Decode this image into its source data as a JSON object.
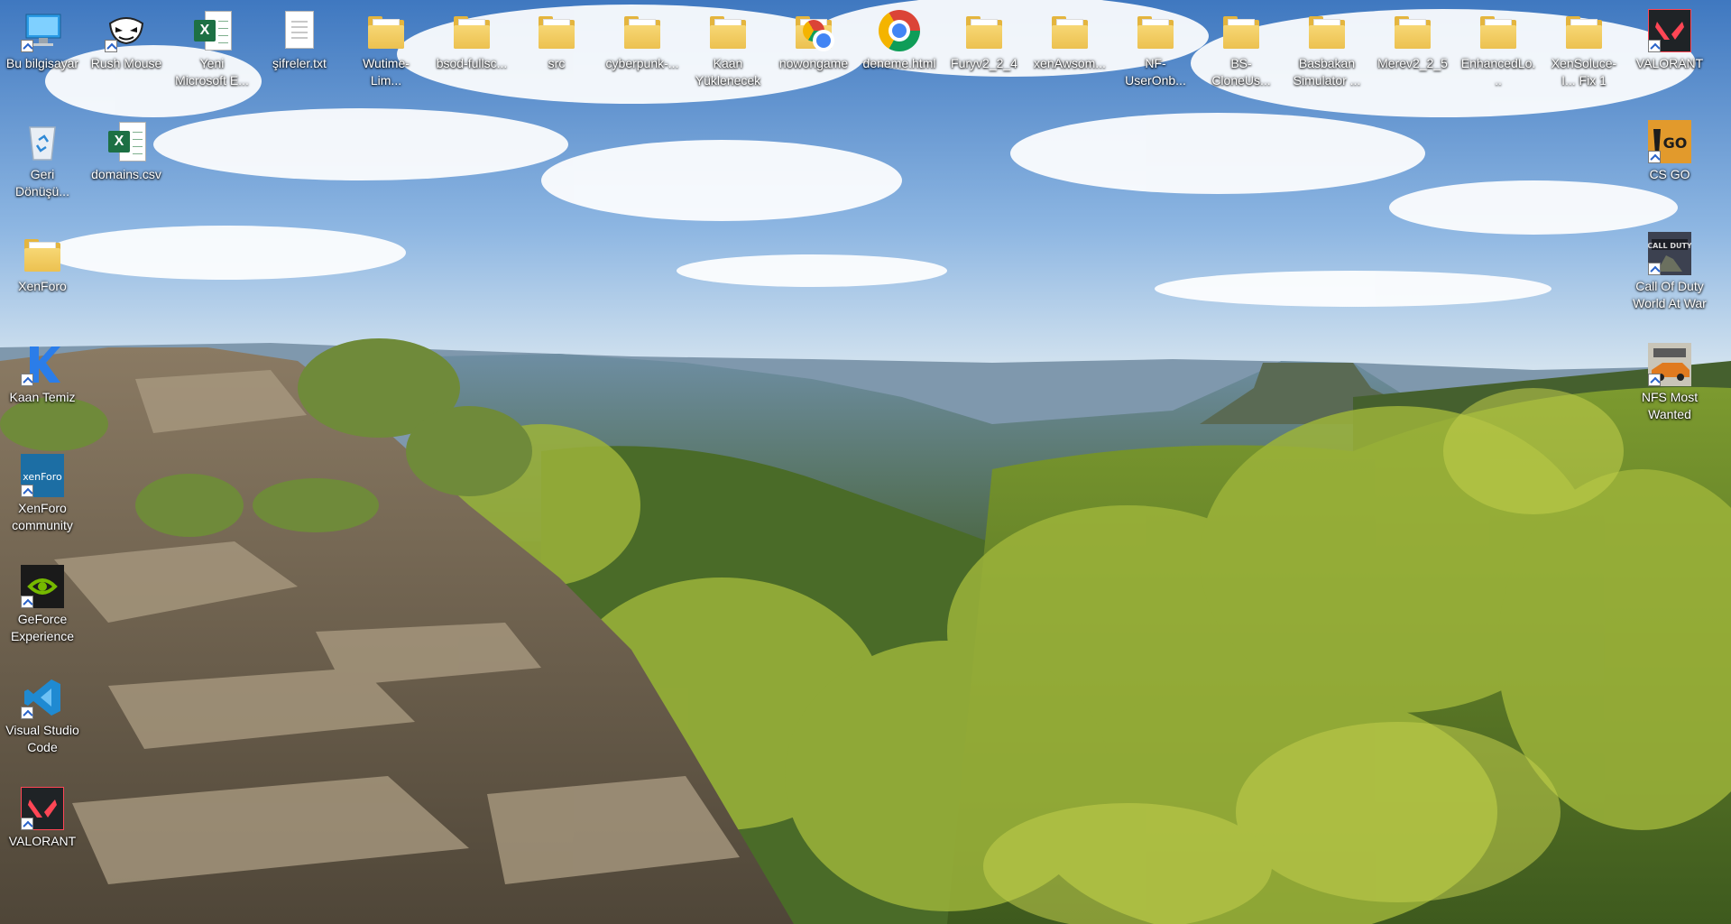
{
  "desktop": {
    "icons": [
      {
        "id": "bu-bilgisayar",
        "label": "Bu bilgisayar",
        "icon": "monitor-icon"
      },
      {
        "id": "rush-mouse",
        "label": "Rush Mouse",
        "icon": "rush-mouse-icon"
      },
      {
        "id": "yeni-microsoft-excel",
        "label": "Yeni Microsoft E...",
        "icon": "excel-icon"
      },
      {
        "id": "sifreler-txt",
        "label": "şifreler.txt",
        "icon": "text-file-icon"
      },
      {
        "id": "wutime-lim",
        "label": "Wutime-Lim...",
        "icon": "folder-icon"
      },
      {
        "id": "bsod-fullsc",
        "label": "bsod-fullsc...",
        "icon": "folder-icon"
      },
      {
        "id": "src",
        "label": "src",
        "icon": "folder-icon"
      },
      {
        "id": "cyberpunk",
        "label": "cyberpunk-...",
        "icon": "folder-icon"
      },
      {
        "id": "kaan-yuklenecek",
        "label": "Kaan Yüklenecek",
        "icon": "folder-icon"
      },
      {
        "id": "nowongame",
        "label": "nowongame",
        "icon": "folder-chrome-icon"
      },
      {
        "id": "deneme-html",
        "label": "deneme.html",
        "icon": "chrome-icon"
      },
      {
        "id": "furyv2",
        "label": "Furyv2_2_4",
        "icon": "folder-icon"
      },
      {
        "id": "xenawsom",
        "label": "xenAwsom...",
        "icon": "folder-icon"
      },
      {
        "id": "nf-useronb",
        "label": "NF-UserOnb...",
        "icon": "folder-icon"
      },
      {
        "id": "bs-cloneus",
        "label": "BS-CloneUs...",
        "icon": "folder-icon"
      },
      {
        "id": "basbakan-simulator",
        "label": "Basbakan Simulator ...",
        "icon": "folder-icon"
      },
      {
        "id": "merev2",
        "label": "Merev2_2_5",
        "icon": "folder-icon"
      },
      {
        "id": "enhancedlo",
        "label": "EnhancedLo...",
        "icon": "folder-icon"
      },
      {
        "id": "xensoluce",
        "label": "XenSoluce-I... Fix 1",
        "icon": "folder-icon"
      },
      {
        "id": "valorant-top",
        "label": "VALORANT",
        "icon": "valorant-icon"
      },
      {
        "id": "geri-donusum",
        "label": "Geri Dönüşü...",
        "icon": "recycle-bin-icon"
      },
      {
        "id": "domains-csv",
        "label": "domains.csv",
        "icon": "excel-csv-icon"
      },
      {
        "id": "xenforo",
        "label": "XenForo",
        "icon": "folder-icon"
      },
      {
        "id": "kaan-temiz",
        "label": "Kaan Temiz",
        "icon": "k-app-icon"
      },
      {
        "id": "xenforo-community",
        "label": "XenForo community",
        "icon": "xenforo-icon"
      },
      {
        "id": "geforce-experience",
        "label": "GeForce Experience",
        "icon": "nvidia-icon"
      },
      {
        "id": "visual-studio-code",
        "label": "Visual Studio Code",
        "icon": "vscode-icon"
      },
      {
        "id": "valorant-left",
        "label": "VALORANT",
        "icon": "valorant-icon"
      },
      {
        "id": "cs-go",
        "label": "CS GO",
        "icon": "csgo-icon"
      },
      {
        "id": "call-of-duty",
        "label": "Call Of Duty World At War",
        "icon": "cod-icon"
      },
      {
        "id": "nfs-most-wanted",
        "label": "NFS Most Wanted",
        "icon": "nfs-icon"
      }
    ]
  }
}
